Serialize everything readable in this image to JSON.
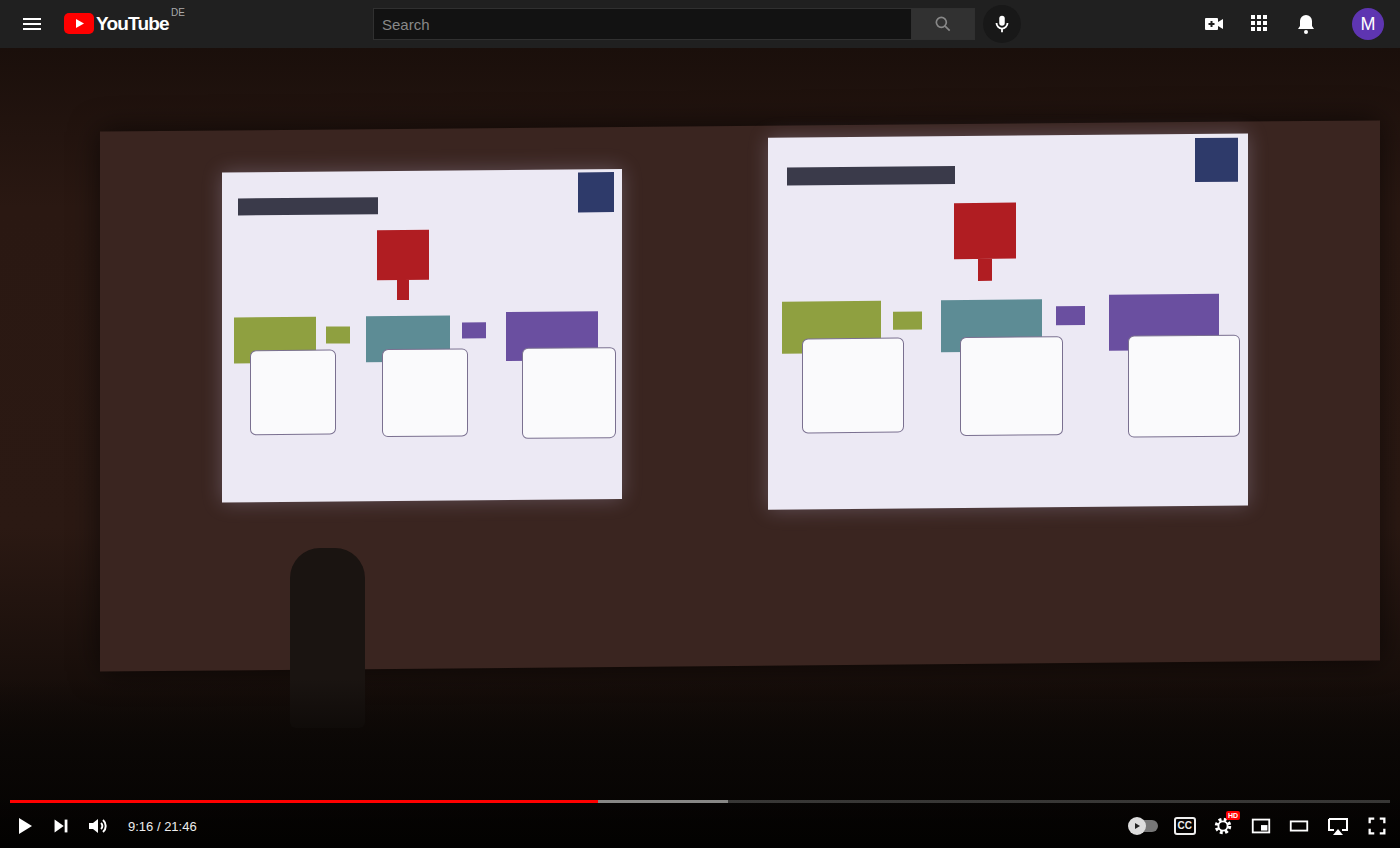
{
  "header": {
    "logo": "YouTube",
    "region": "DE",
    "search": {
      "placeholder": "Search"
    },
    "avatar": "M"
  },
  "player": {
    "playing": false,
    "progress": {
      "level": 0.426,
      "buffered": 0.52
    },
    "time": "9:16 / 21:46",
    "autoplay": {
      "on": false
    },
    "cc": "CC",
    "settings_badge": "HD"
  }
}
